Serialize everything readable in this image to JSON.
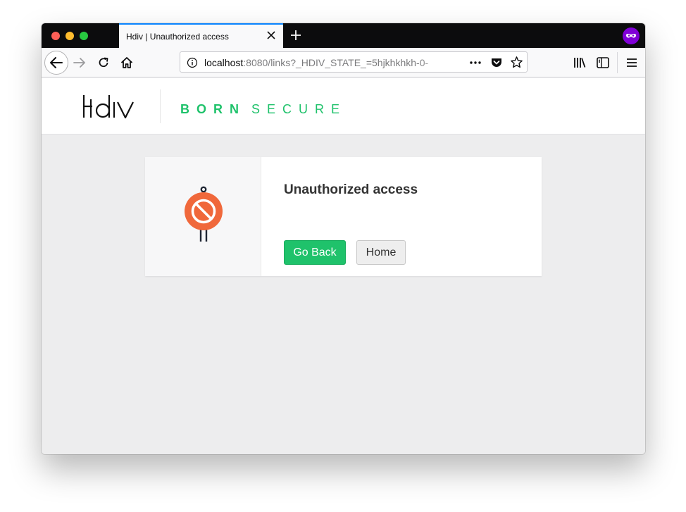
{
  "browser": {
    "tab_title": "Hdiv | Unauthorized access",
    "url_host": "localhost",
    "url_rest": ":8080/links?_HDIV_STATE_=5hjkhkhkh-0-",
    "icons": {
      "close": "close-icon",
      "new_tab": "plus-icon",
      "private": "private-browsing-mask-icon",
      "back": "back-arrow-icon",
      "forward": "forward-arrow-icon",
      "reload": "reload-icon",
      "home": "home-icon",
      "info": "info-icon",
      "page_actions": "ellipsis-icon",
      "pocket": "pocket-icon",
      "bookmark": "star-icon",
      "library": "library-icon",
      "sidebar": "sidebar-icon",
      "menu": "hamburger-menu-icon"
    }
  },
  "header": {
    "logo": "Hdiv",
    "tagline_bold": "BORN",
    "tagline_light": "SECURE"
  },
  "card": {
    "title": "Unauthorized access",
    "illustration": "prohibited-sign-icon",
    "go_back_label": "Go Back",
    "home_label": "Home"
  },
  "colors": {
    "brand_green": "#1fc26b",
    "sign_orange": "#f0683b",
    "tab_accent": "#0a84ff",
    "private_purple": "#8000d7"
  }
}
